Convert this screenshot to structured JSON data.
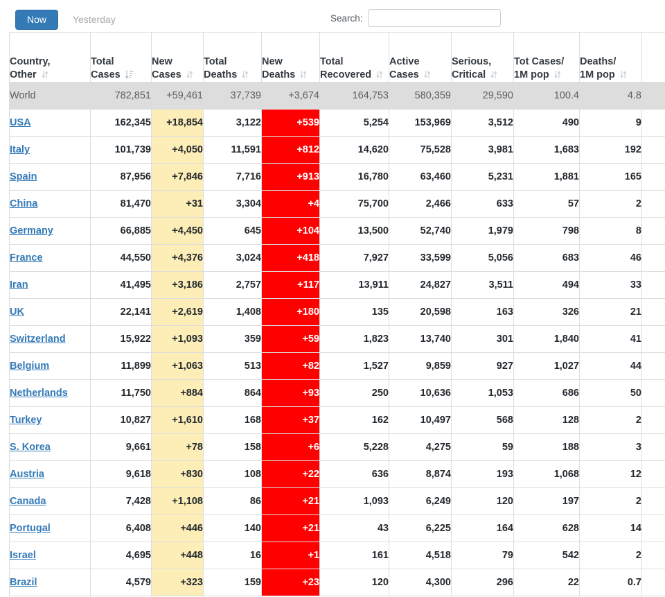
{
  "toolbar": {
    "now_label": "Now",
    "yesterday_label": "Yesterday",
    "search_label": "Search:",
    "search_value": "",
    "search_placeholder": ""
  },
  "colors": {
    "accent": "#337ab7",
    "new_cases_bg": "#fdeeb8",
    "new_deaths_bg": "#ff0000",
    "world_row_bg": "#dddddd",
    "link": "#337ab7"
  },
  "table": {
    "columns": [
      {
        "key": "country",
        "label_line1": "Country,",
        "label_line2": "Other",
        "sort": "both"
      },
      {
        "key": "tot_cases",
        "label_line1": "Total",
        "label_line2": "Cases",
        "sort": "desc"
      },
      {
        "key": "new_cases",
        "label_line1": "New",
        "label_line2": "Cases",
        "sort": "both"
      },
      {
        "key": "tot_deaths",
        "label_line1": "Total",
        "label_line2": "Deaths",
        "sort": "both"
      },
      {
        "key": "new_deaths",
        "label_line1": "New",
        "label_line2": "Deaths",
        "sort": "both"
      },
      {
        "key": "tot_rec",
        "label_line1": "Total",
        "label_line2": "Recovered",
        "sort": "both"
      },
      {
        "key": "active",
        "label_line1": "Active",
        "label_line2": "Cases",
        "sort": "both"
      },
      {
        "key": "serious",
        "label_line1": "Serious,",
        "label_line2": "Critical",
        "sort": "both"
      },
      {
        "key": "tcpm",
        "label_line1": "Tot Cases/",
        "label_line2": "1M pop",
        "sort": "both"
      },
      {
        "key": "dpm",
        "label_line1": "Deaths/",
        "label_line2": "1M pop",
        "sort": "both"
      },
      {
        "key": "extra",
        "label_line1": "",
        "label_line2": "",
        "sort": "none"
      }
    ],
    "world_row": {
      "country": "World",
      "tot_cases": "782,851",
      "new_cases": "+59,461",
      "tot_deaths": "37,739",
      "new_deaths": "+3,674",
      "tot_rec": "164,753",
      "active": "580,359",
      "serious": "29,590",
      "tcpm": "100.4",
      "dpm": "4.8",
      "extra": ""
    },
    "rows": [
      {
        "country": "USA",
        "tot_cases": "162,345",
        "new_cases": "+18,854",
        "tot_deaths": "3,122",
        "new_deaths": "+539",
        "tot_rec": "5,254",
        "active": "153,969",
        "serious": "3,512",
        "tcpm": "490",
        "dpm": "9",
        "extra": ""
      },
      {
        "country": "Italy",
        "tot_cases": "101,739",
        "new_cases": "+4,050",
        "tot_deaths": "11,591",
        "new_deaths": "+812",
        "tot_rec": "14,620",
        "active": "75,528",
        "serious": "3,981",
        "tcpm": "1,683",
        "dpm": "192",
        "extra": ""
      },
      {
        "country": "Spain",
        "tot_cases": "87,956",
        "new_cases": "+7,846",
        "tot_deaths": "7,716",
        "new_deaths": "+913",
        "tot_rec": "16,780",
        "active": "63,460",
        "serious": "5,231",
        "tcpm": "1,881",
        "dpm": "165",
        "extra": ""
      },
      {
        "country": "China",
        "tot_cases": "81,470",
        "new_cases": "+31",
        "tot_deaths": "3,304",
        "new_deaths": "+4",
        "tot_rec": "75,700",
        "active": "2,466",
        "serious": "633",
        "tcpm": "57",
        "dpm": "2",
        "extra": ""
      },
      {
        "country": "Germany",
        "tot_cases": "66,885",
        "new_cases": "+4,450",
        "tot_deaths": "645",
        "new_deaths": "+104",
        "tot_rec": "13,500",
        "active": "52,740",
        "serious": "1,979",
        "tcpm": "798",
        "dpm": "8",
        "extra": ""
      },
      {
        "country": "France",
        "tot_cases": "44,550",
        "new_cases": "+4,376",
        "tot_deaths": "3,024",
        "new_deaths": "+418",
        "tot_rec": "7,927",
        "active": "33,599",
        "serious": "5,056",
        "tcpm": "683",
        "dpm": "46",
        "extra": ""
      },
      {
        "country": "Iran",
        "tot_cases": "41,495",
        "new_cases": "+3,186",
        "tot_deaths": "2,757",
        "new_deaths": "+117",
        "tot_rec": "13,911",
        "active": "24,827",
        "serious": "3,511",
        "tcpm": "494",
        "dpm": "33",
        "extra": ""
      },
      {
        "country": "UK",
        "tot_cases": "22,141",
        "new_cases": "+2,619",
        "tot_deaths": "1,408",
        "new_deaths": "+180",
        "tot_rec": "135",
        "active": "20,598",
        "serious": "163",
        "tcpm": "326",
        "dpm": "21",
        "extra": ""
      },
      {
        "country": "Switzerland",
        "tot_cases": "15,922",
        "new_cases": "+1,093",
        "tot_deaths": "359",
        "new_deaths": "+59",
        "tot_rec": "1,823",
        "active": "13,740",
        "serious": "301",
        "tcpm": "1,840",
        "dpm": "41",
        "extra": ""
      },
      {
        "country": "Belgium",
        "tot_cases": "11,899",
        "new_cases": "+1,063",
        "tot_deaths": "513",
        "new_deaths": "+82",
        "tot_rec": "1,527",
        "active": "9,859",
        "serious": "927",
        "tcpm": "1,027",
        "dpm": "44",
        "extra": ""
      },
      {
        "country": "Netherlands",
        "tot_cases": "11,750",
        "new_cases": "+884",
        "tot_deaths": "864",
        "new_deaths": "+93",
        "tot_rec": "250",
        "active": "10,636",
        "serious": "1,053",
        "tcpm": "686",
        "dpm": "50",
        "extra": ""
      },
      {
        "country": "Turkey",
        "tot_cases": "10,827",
        "new_cases": "+1,610",
        "tot_deaths": "168",
        "new_deaths": "+37",
        "tot_rec": "162",
        "active": "10,497",
        "serious": "568",
        "tcpm": "128",
        "dpm": "2",
        "extra": ""
      },
      {
        "country": "S. Korea",
        "tot_cases": "9,661",
        "new_cases": "+78",
        "tot_deaths": "158",
        "new_deaths": "+6",
        "tot_rec": "5,228",
        "active": "4,275",
        "serious": "59",
        "tcpm": "188",
        "dpm": "3",
        "extra": ""
      },
      {
        "country": "Austria",
        "tot_cases": "9,618",
        "new_cases": "+830",
        "tot_deaths": "108",
        "new_deaths": "+22",
        "tot_rec": "636",
        "active": "8,874",
        "serious": "193",
        "tcpm": "1,068",
        "dpm": "12",
        "extra": ""
      },
      {
        "country": "Canada",
        "tot_cases": "7,428",
        "new_cases": "+1,108",
        "tot_deaths": "86",
        "new_deaths": "+21",
        "tot_rec": "1,093",
        "active": "6,249",
        "serious": "120",
        "tcpm": "197",
        "dpm": "2",
        "extra": ""
      },
      {
        "country": "Portugal",
        "tot_cases": "6,408",
        "new_cases": "+446",
        "tot_deaths": "140",
        "new_deaths": "+21",
        "tot_rec": "43",
        "active": "6,225",
        "serious": "164",
        "tcpm": "628",
        "dpm": "14",
        "extra": ""
      },
      {
        "country": "Israel",
        "tot_cases": "4,695",
        "new_cases": "+448",
        "tot_deaths": "16",
        "new_deaths": "+1",
        "tot_rec": "161",
        "active": "4,518",
        "serious": "79",
        "tcpm": "542",
        "dpm": "2",
        "extra": ""
      },
      {
        "country": "Brazil",
        "tot_cases": "4,579",
        "new_cases": "+323",
        "tot_deaths": "159",
        "new_deaths": "+23",
        "tot_rec": "120",
        "active": "4,300",
        "serious": "296",
        "tcpm": "22",
        "dpm": "0.7",
        "extra": ""
      }
    ]
  }
}
